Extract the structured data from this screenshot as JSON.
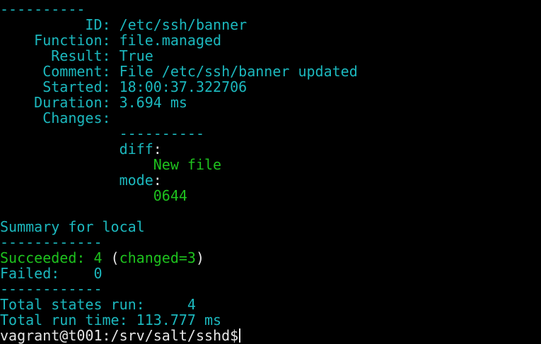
{
  "state": {
    "separator": "----------",
    "id_label": "ID:",
    "id_value": "/etc/ssh/banner",
    "function_label": "Function:",
    "function_value": "file.managed",
    "result_label": "Result:",
    "result_value": "True",
    "comment_label": "Comment:",
    "comment_value": "File /etc/ssh/banner updated",
    "started_label": "Started:",
    "started_value": "18:00:37.322706",
    "duration_label": "Duration:",
    "duration_value": "3.694 ms",
    "changes_label": "Changes:",
    "changes_separator": "----------",
    "diff_label": "diff",
    "diff_value": "New file",
    "mode_label": "mode",
    "mode_value": "0644"
  },
  "summary": {
    "title": "Summary for local",
    "separator": "------------",
    "succeeded_label": "Succeeded: 4",
    "changed_text": "changed=3",
    "failed_label": "Failed:",
    "failed_value": "0",
    "separator2": "------------",
    "total_states": "Total states run:     4",
    "total_time": "Total run time: 113.777 ms"
  },
  "prompt": {
    "text": "vagrant@t001:/srv/salt/sshd$"
  },
  "colors": {
    "background": "#000000",
    "cyan": "#1cb8be",
    "green": "#1ec21e",
    "white": "#e6e6e6"
  }
}
